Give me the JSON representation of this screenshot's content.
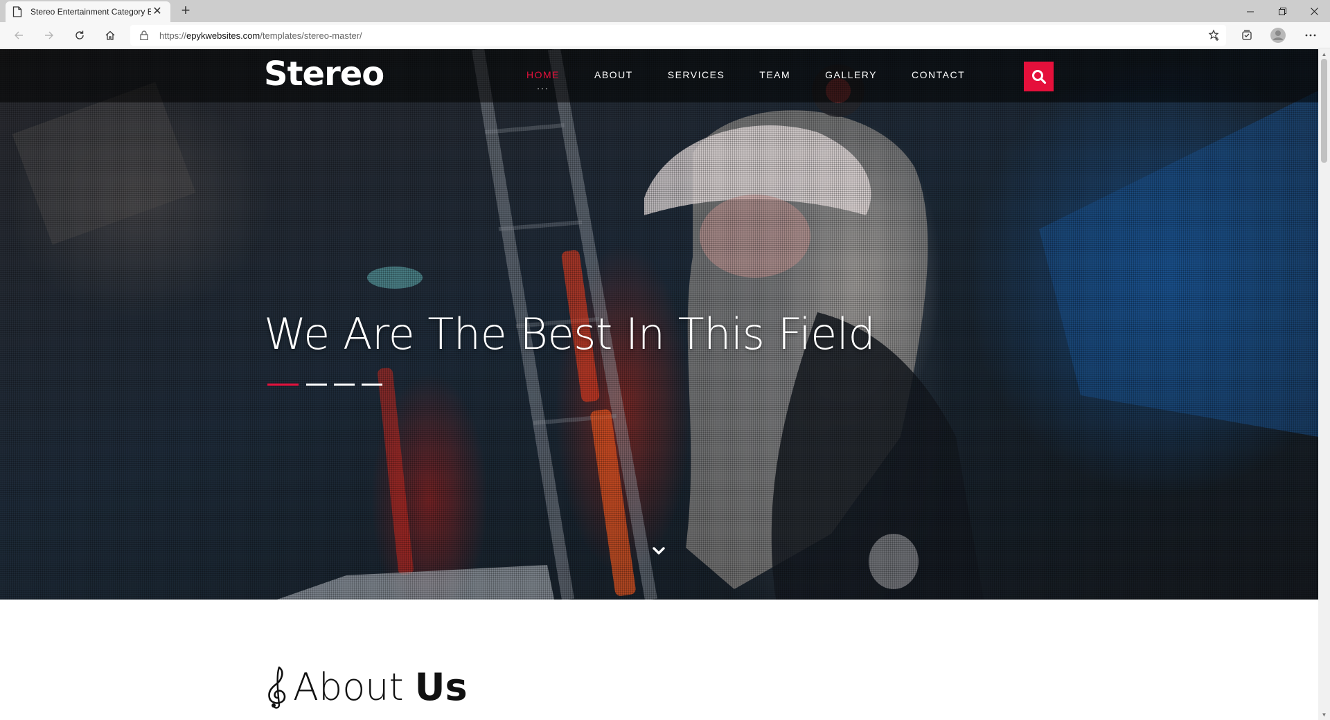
{
  "browser": {
    "tab_title": "Stereo Entertainment Category E",
    "url_scheme": "https://",
    "url_host": "epykwebsites.com",
    "url_path": "/templates/stereo-master/"
  },
  "site": {
    "logo": "Stereo",
    "nav": [
      {
        "label": "HOME",
        "active": true
      },
      {
        "label": "ABOUT"
      },
      {
        "label": "SERVICES"
      },
      {
        "label": "TEAM"
      },
      {
        "label": "GALLERY"
      },
      {
        "label": "CONTACT"
      }
    ],
    "active_dots": "...",
    "hero_title": "We Are The Best In This Field",
    "about_title_light": "About",
    "about_title_bold": "Us"
  },
  "colors": {
    "accent": "#e5103b",
    "header_bg": "rgba(0,0,0,0.55)"
  },
  "icons": [
    "page-icon",
    "close-icon",
    "plus-icon",
    "minimize-icon",
    "restore-icon",
    "window-close-icon",
    "back-icon",
    "forward-icon",
    "refresh-icon",
    "home-icon",
    "lock-icon",
    "favorites-icon",
    "collections-icon",
    "profile-icon",
    "more-icon",
    "search-icon",
    "chevron-down-icon",
    "treble-clef-icon"
  ]
}
